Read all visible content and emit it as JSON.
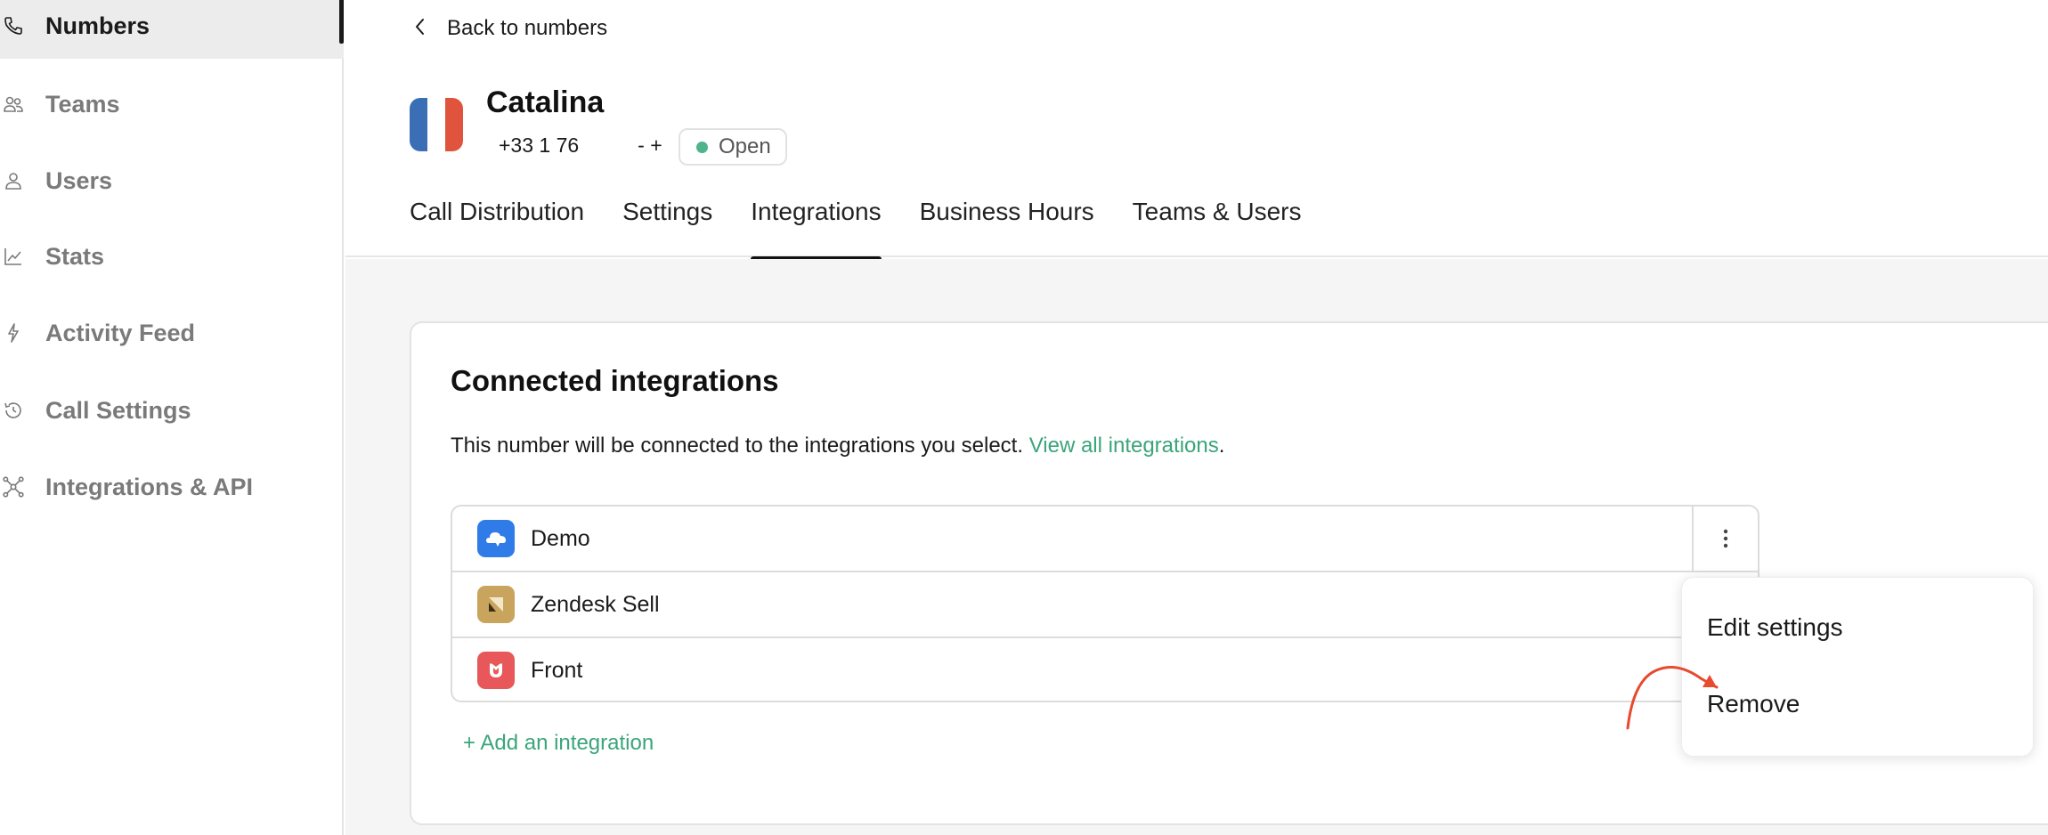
{
  "sidebar": {
    "items": [
      {
        "label": "Numbers",
        "icon": "phone-icon",
        "active": true
      },
      {
        "label": "Teams",
        "icon": "teams-icon",
        "active": false
      },
      {
        "label": "Users",
        "icon": "user-icon",
        "active": false
      },
      {
        "label": "Stats",
        "icon": "chart-icon",
        "active": false
      },
      {
        "label": "Activity Feed",
        "icon": "bolt-icon",
        "active": false
      },
      {
        "label": "Call Settings",
        "icon": "history-icon",
        "active": false
      },
      {
        "label": "Integrations & API",
        "icon": "network-icon",
        "active": false
      }
    ]
  },
  "header": {
    "back_label": "Back to numbers",
    "title": "Catalina",
    "phone_start": "+33 1 76",
    "phone_end": "- +",
    "status": "Open",
    "flag_colors": [
      "#3a6fb5",
      "#ffffff",
      "#e0533d"
    ]
  },
  "tabs": [
    {
      "label": "Call Distribution",
      "active": false
    },
    {
      "label": "Settings",
      "active": false
    },
    {
      "label": "Integrations",
      "active": true
    },
    {
      "label": "Business Hours",
      "active": false
    },
    {
      "label": "Teams & Users",
      "active": false
    }
  ],
  "card": {
    "title": "Connected integrations",
    "description": "This number will be connected to the integrations you select.",
    "link": "View all integrations",
    "period": ".",
    "integrations": [
      {
        "name": "Demo",
        "icon": "demo-app-icon",
        "color": "#2f7be8"
      },
      {
        "name": "Zendesk Sell",
        "icon": "zendesk-sell-icon",
        "color": "#c9a45c"
      },
      {
        "name": "Front",
        "icon": "front-app-icon",
        "color": "#e8585a"
      }
    ],
    "add_label": "+ Add an integration"
  },
  "menu": {
    "edit": "Edit settings",
    "remove": "Remove"
  },
  "colors": {
    "accent": "#3aa57a",
    "status_dot": "#4fb38c",
    "arrow": "#e8492f"
  }
}
